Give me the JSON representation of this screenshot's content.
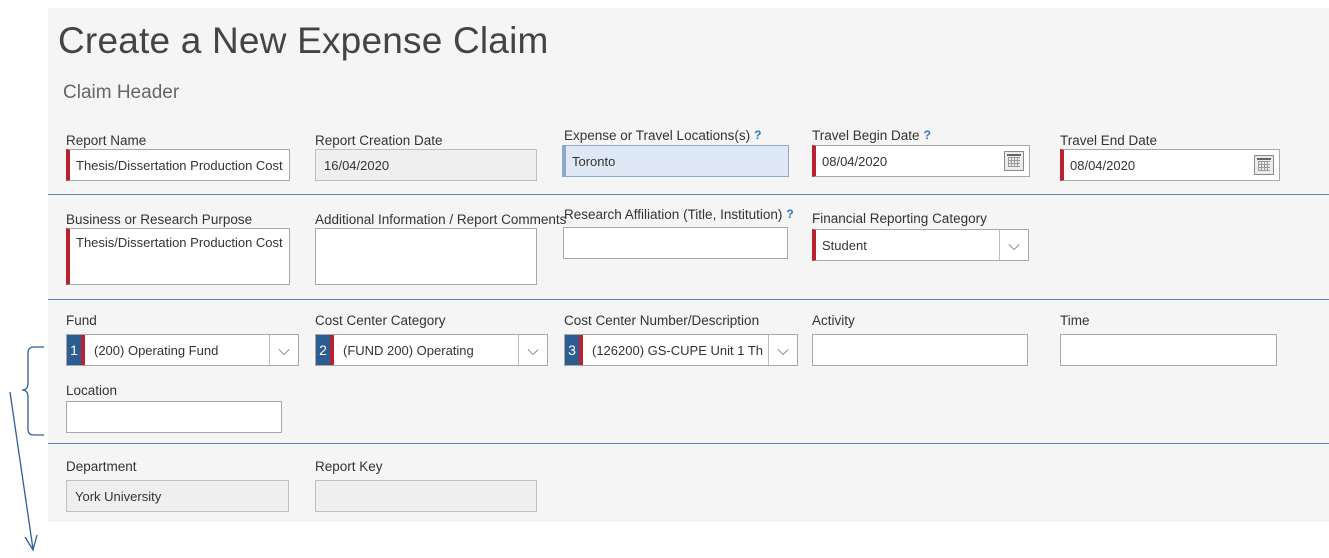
{
  "page": {
    "title": "Create a New Expense Claim",
    "section": "Claim Header"
  },
  "fields": {
    "report_name": {
      "label": "Report Name",
      "value": "Thesis/Dissertation Production Cost"
    },
    "report_creation_date": {
      "label": "Report Creation Date",
      "value": "16/04/2020"
    },
    "locations": {
      "label": "Expense or Travel Locations(s)",
      "value": "Toronto"
    },
    "travel_begin": {
      "label": "Travel Begin Date",
      "value": "08/04/2020"
    },
    "travel_end": {
      "label": "Travel End Date",
      "value": "08/04/2020"
    },
    "purpose": {
      "label": "Business or Research Purpose",
      "value": "Thesis/Dissertation Production Cost"
    },
    "additional_info": {
      "label": "Additional Information / Report Comments",
      "value": ""
    },
    "research_affiliation": {
      "label": "Research Affiliation (Title, Institution)",
      "value": ""
    },
    "financial_category": {
      "label": "Financial Reporting Category",
      "value": "Student"
    },
    "fund": {
      "label": "Fund",
      "number": "1",
      "value": "(200) Operating Fund"
    },
    "cost_center_category": {
      "label": "Cost Center Category",
      "number": "2",
      "value": "(FUND 200) Operating"
    },
    "cost_center_number": {
      "label": "Cost Center Number/Description",
      "number": "3",
      "value": "(126200) GS-CUPE Unit 1 Th"
    },
    "activity": {
      "label": "Activity",
      "value": ""
    },
    "time": {
      "label": "Time",
      "value": ""
    },
    "location": {
      "label": "Location",
      "value": ""
    },
    "department": {
      "label": "Department",
      "value": "York University"
    },
    "report_key": {
      "label": "Report Key",
      "value": ""
    }
  },
  "icons": {
    "help": "?",
    "chevron": "⌵"
  },
  "colors": {
    "required": "#b8212f",
    "number_badge": "#2c5d92",
    "help": "#2b78c5"
  }
}
